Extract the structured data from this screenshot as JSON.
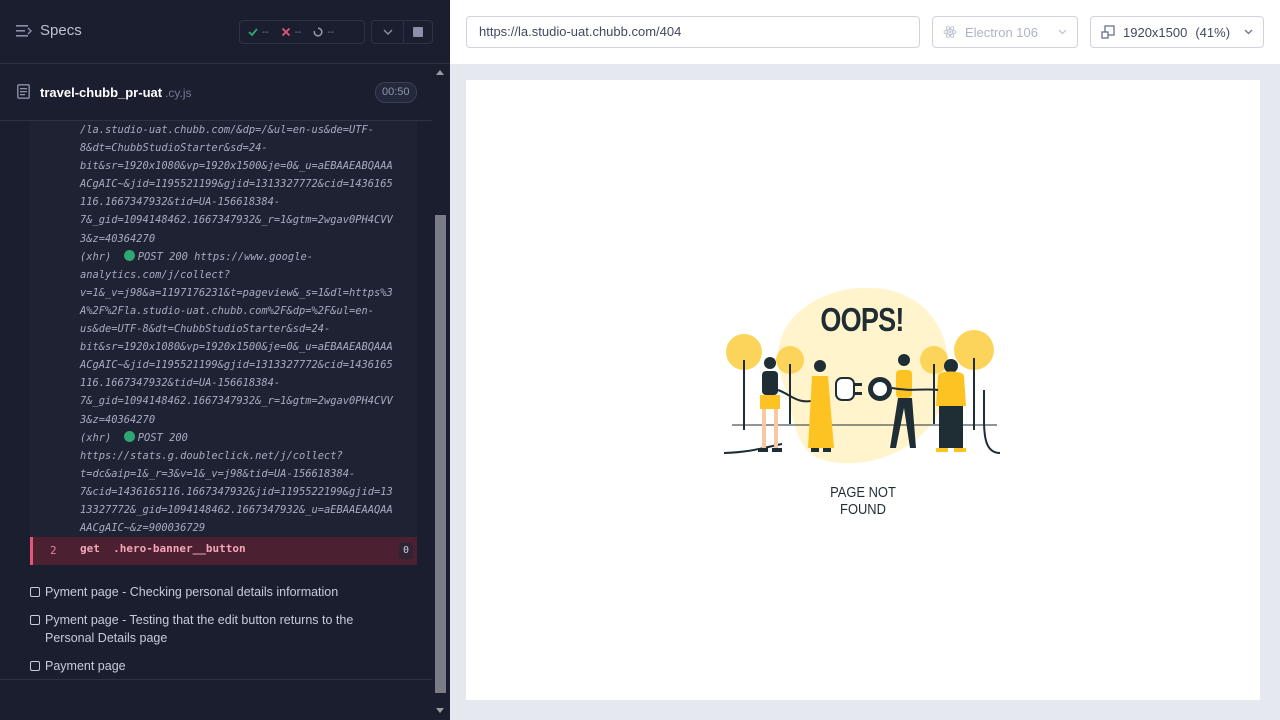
{
  "reporter": {
    "specs_label": "Specs",
    "stats": {
      "passed": "--",
      "failed": "--",
      "pending": "--"
    },
    "spec": {
      "name": "travel-chubb_pr-uat",
      "ext": ".cy.js",
      "duration": "00:50"
    },
    "log_lines": [
      "/la.studio-uat.chubb.com/&dp=/&ul=en-us&de=UTF-",
      "8&dt=ChubbStudioStarter&sd=24-",
      "bit&sr=1920x1080&vp=1920x1500&je=0&_u=aEBAAEABQAAA",
      "ACgAIC~&jid=1195521199&gjid=1313327772&cid=1436165",
      "116.1667347932&tid=UA-156618384-",
      "7&_gid=1094148462.1667347932&_r=1&gtm=2wgav0PH4CVV",
      "3&z=40364270",
      "(xhr)  ●POST 200 https://www.google-",
      "analytics.com/j/collect?",
      "v=1&_v=j98&a=1197176231&t=pageview&_s=1&dl=https%3",
      "A%2F%2Fla.studio-uat.chubb.com%2F&dp=%2F&ul=en-",
      "us&de=UTF-8&dt=ChubbStudioStarter&sd=24-",
      "bit&sr=1920x1080&vp=1920x1500&je=0&_u=aEBAAEABQAAA",
      "ACgAIC~&jid=1195521199&gjid=1313327772&cid=1436165",
      "116.1667347932&tid=UA-156618384-",
      "7&_gid=1094148462.1667347932&_r=1&gtm=2wgav0PH4CVV",
      "3&z=40364270",
      "(xhr)  ●POST 200",
      "https://stats.g.doubleclick.net/j/collect?",
      "t=dc&aip=1&_r=3&v=1&_v=j98&tid=UA-156618384-",
      "7&cid=1436165116.1667347932&jid=1195522199&gjid=13",
      "13327772&_gid=1094148462.1667347932&_u=aEBAAEAAQAA",
      "AACgAIC~&z=900036729"
    ],
    "error_row": {
      "number": "2",
      "command": "get  .hero-banner__button",
      "count": "0"
    },
    "tests": [
      {
        "title": "Pyment page - Checking personal details information"
      },
      {
        "title": "Pyment page - Testing that the edit button returns to the",
        "title2": "Personal Details page"
      },
      {
        "title": "Payment page"
      }
    ]
  },
  "aut": {
    "url": "https://la.studio-uat.chubb.com/404",
    "browser": "Electron 106",
    "viewport": "1920x1500",
    "zoom": "(41%)"
  },
  "page": {
    "heading": "OOPS!",
    "subtitle": "PAGE NOT FOUND"
  },
  "colors": {
    "reporter_bg": "#1b1e2e",
    "error_bg": "#4b2132",
    "pass": "#2fa772",
    "fail": "#e4567a",
    "illustration_yellow": "#fdc322"
  }
}
